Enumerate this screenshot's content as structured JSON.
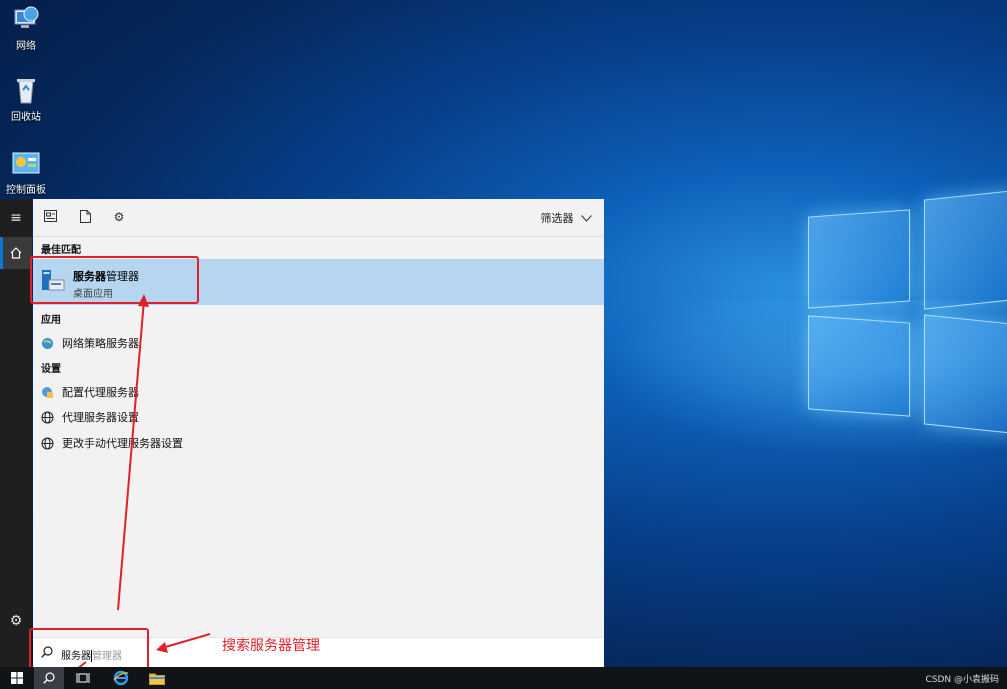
{
  "desktop": {
    "icons": [
      {
        "label": "网络"
      },
      {
        "label": "回收站"
      },
      {
        "label": "控制面板"
      }
    ]
  },
  "search": {
    "filter_label": "筛选器",
    "best_match_header": "最佳匹配",
    "best_match": {
      "name_bold": "服务器",
      "name_rest": "管理器",
      "subtitle": "桌面应用"
    },
    "apps_header": "应用",
    "apps": [
      {
        "label": "网络策略服务器"
      }
    ],
    "settings_header": "设置",
    "settings": [
      {
        "label": "配置代理服务器"
      },
      {
        "label": "代理服务器设置"
      },
      {
        "label": "更改手动代理服务器设置"
      }
    ],
    "query_typed": "服务器",
    "query_hint": "管理器"
  },
  "annotation": {
    "text": "搜索服务器管理",
    "color": "#e0202a"
  },
  "taskbar": {
    "watermark": "CSDN @小袁搬码"
  },
  "colors": {
    "accent": "#0a78d7",
    "selected": "#b5d5f0"
  }
}
